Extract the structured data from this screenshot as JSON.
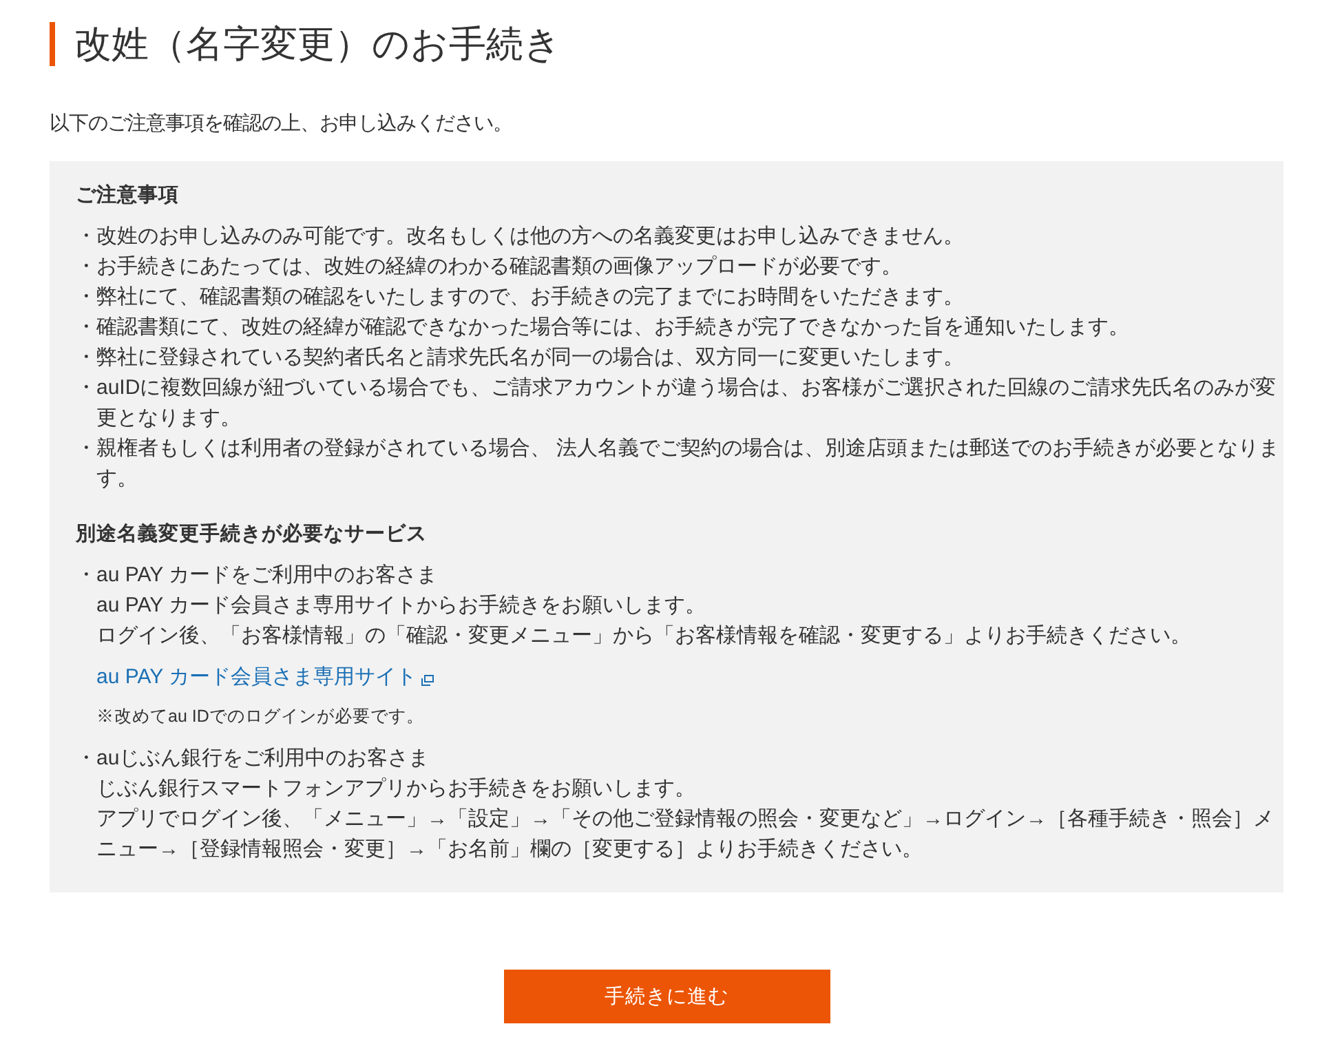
{
  "title": "改姓（名字変更）のお手続き",
  "intro": "以下のご注意事項を確認の上、お申し込みください。",
  "notice": {
    "heading": "ご注意事項",
    "items": [
      "・改姓のお申し込みのみ可能です。改名もしくは他の方への名義変更はお申し込みできません。",
      "・お手続きにあたっては、改姓の経緯のわかる確認書類の画像アップロードが必要です。",
      "・弊社にて、確認書類の確認をいたしますので、お手続きの完了までにお時間をいただきます。",
      "・確認書類にて、改姓の経緯が確認できなかった場合等には、お手続きが完了できなかった旨を通知いたします。",
      "・弊社に登録されている契約者氏名と請求先氏名が同一の場合は、双方同一に変更いたします。",
      "・auIDに複数回線が紐づいている場合でも、ご請求アカウントが違う場合は、お客様がご選択された回線のご請求先氏名のみが変更となります。",
      "・親権者もしくは利用者の登録がされている場合、 法人名義でご契約の場合は、別途店頭または郵送でのお手続きが必要となります。"
    ]
  },
  "services": {
    "heading": "別途名義変更手続きが必要なサービス",
    "items": [
      {
        "title": "・au PAY カードをご利用中のお客さま",
        "lines": [
          "au PAY カード会員さま専用サイトからお手続きをお願いします。",
          "ログイン後、「お客様情報」の「確認・変更メニュー」から「お客様情報を確認・変更する」よりお手続きください。"
        ],
        "link": "au PAY カード会員さま専用サイト",
        "note": "※改めてau IDでのログインが必要です。"
      },
      {
        "title": "・auじぶん銀行をご利用中のお客さま",
        "lines": [
          "じぶん銀行スマートフォンアプリからお手続きをお願いします。",
          "アプリでログイン後、「メニュー」→「設定」→「その他ご登録情報の照会・変更など」→ログイン→［各種手続き・照会］メニュー→［登録情報照会・変更］→「お名前」欄の［変更する］よりお手続きください。"
        ]
      }
    ]
  },
  "button": "手続きに進む"
}
